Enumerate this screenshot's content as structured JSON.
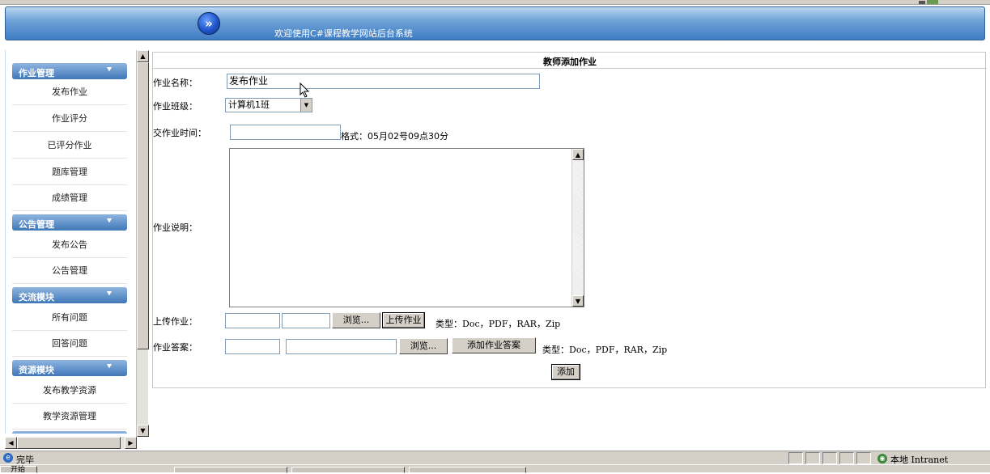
{
  "header": {
    "title": "欢迎使用C#课程教学网站后台系统",
    "logo_glyph": "»"
  },
  "sidebar": {
    "sections": [
      {
        "label": "作业管理",
        "items": [
          "发布作业",
          "作业评分",
          "已评分作业",
          "题库管理",
          "成绩管理"
        ]
      },
      {
        "label": "公告管理",
        "items": [
          "发布公告",
          "公告管理"
        ]
      },
      {
        "label": "交流模块",
        "items": [
          "所有问题",
          "回答问题"
        ]
      },
      {
        "label": "资源模块",
        "items": [
          "发布教学资源",
          "教学资源管理"
        ]
      }
    ],
    "chevron": "»"
  },
  "form": {
    "title": "教师添加作业",
    "name_label": "作业名称：",
    "name_value": "发布作业",
    "class_label": "作业班级：",
    "class_value": "计算机1班",
    "time_label": "交作业时间：",
    "time_value": "",
    "time_hint": "格式：05月02号09点30分",
    "desc_label": "作业说明：",
    "upload_label": "上传作业：",
    "browse_label": "浏览...",
    "upload_button": "上传作业",
    "upload_types": "类型：Doc，PDF，RAR，Zip",
    "answer_label": "作业答案：",
    "answer_browse_label": "浏览...",
    "add_answer_button": "添加作业答案",
    "answer_types": "类型：Doc，PDF，RAR，Zip",
    "submit_button": "添加"
  },
  "statusbar": {
    "status": "完毕",
    "zone": "本地 Intranet"
  },
  "taskbar": {
    "start": "开始"
  },
  "icons": [
    "ie-logo-icon",
    "globe-icon",
    "scroll-up-icon",
    "scroll-down-icon",
    "scroll-left-icon",
    "scroll-right-icon",
    "chevron-down-icon",
    "mouse-cursor-icon"
  ]
}
